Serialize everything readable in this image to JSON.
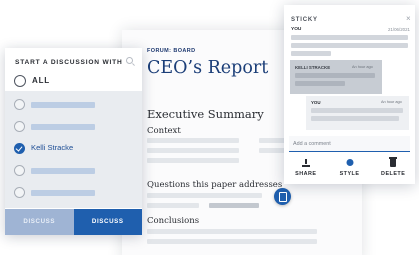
{
  "document": {
    "kicker": "FORUM: BOARD",
    "title": "CEO’s Report",
    "heading": "Executive Summary",
    "sections": [
      "Context",
      "Questions this paper addresses",
      "Conclusions"
    ]
  },
  "discussion": {
    "header": "START A DISCUSSION WITH",
    "all_label": "ALL",
    "selected_name": "Kelli Stracke",
    "footer": {
      "left": "DISCUSS",
      "right": "DISCUSS"
    }
  },
  "sticky": {
    "header": "STICKY",
    "close": "×",
    "author": "YOU",
    "date": "21/06/2021",
    "reply_author": "KELLI STRACKE",
    "reply_time": "An hour ago",
    "own_author": "YOU",
    "own_time": "An hour ago",
    "comment_placeholder": "Add a comment",
    "actions": {
      "share": "SHARE",
      "style": "STYLE",
      "delete": "DELETE"
    }
  },
  "colors": {
    "accent": "#1f5fae",
    "title": "#1b3e78"
  }
}
